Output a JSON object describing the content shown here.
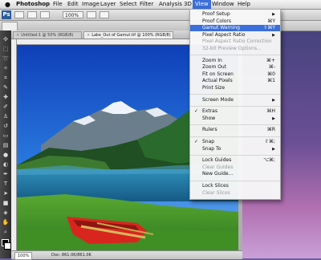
{
  "menubar": {
    "apple": "",
    "app": "Photoshop",
    "items": [
      "File",
      "Edit",
      "Image",
      "Layer",
      "Select",
      "Filter",
      "Analysis",
      "3D",
      "View",
      "Window",
      "Help"
    ]
  },
  "optionsbar": {
    "zoom": "100%"
  },
  "tabs": [
    {
      "label": "Untitled-1 @ 50% (RGB/8)"
    },
    {
      "label": "Lake_Out of Gamut.tif @ 100% (RGB/8)"
    }
  ],
  "window_title": "Lake_Out of Gamut.tif @ 100% (RGB/8)",
  "status": {
    "zoom": "100%",
    "doc": "Doc: 861.0K/861.0K"
  },
  "view_menu": {
    "groups": [
      [
        {
          "label": "Proof Setup",
          "shortcut": "▶",
          "state": "normal"
        },
        {
          "label": "Proof Colors",
          "shortcut": "⌘Y",
          "state": "normal"
        },
        {
          "label": "Gamut Warning",
          "shortcut": "⇧⌘Y",
          "state": "highlight"
        },
        {
          "label": "Pixel Aspect Ratio",
          "shortcut": "▶",
          "state": "normal"
        },
        {
          "label": "Pixel Aspect Ratio Correction",
          "shortcut": "",
          "state": "disabled"
        },
        {
          "label": "32-bit Preview Options...",
          "shortcut": "",
          "state": "disabled"
        }
      ],
      [
        {
          "label": "Zoom In",
          "shortcut": "⌘+",
          "state": "normal"
        },
        {
          "label": "Zoom Out",
          "shortcut": "⌘-",
          "state": "normal"
        },
        {
          "label": "Fit on Screen",
          "shortcut": "⌘0",
          "state": "normal"
        },
        {
          "label": "Actual Pixels",
          "shortcut": "⌘1",
          "state": "normal"
        },
        {
          "label": "Print Size",
          "shortcut": "",
          "state": "normal"
        }
      ],
      [
        {
          "label": "Screen Mode",
          "shortcut": "▶",
          "state": "normal"
        }
      ],
      [
        {
          "label": "Extras",
          "shortcut": "⌘H",
          "state": "checked"
        },
        {
          "label": "Show",
          "shortcut": "▶",
          "state": "normal"
        }
      ],
      [
        {
          "label": "Rulers",
          "shortcut": "⌘R",
          "state": "normal"
        }
      ],
      [
        {
          "label": "Snap",
          "shortcut": "⇧⌘;",
          "state": "checked"
        },
        {
          "label": "Snap To",
          "shortcut": "▶",
          "state": "normal"
        }
      ],
      [
        {
          "label": "Lock Guides",
          "shortcut": "⌥⌘;",
          "state": "normal"
        },
        {
          "label": "Clear Guides",
          "shortcut": "",
          "state": "disabled"
        },
        {
          "label": "New Guide...",
          "shortcut": "",
          "state": "normal"
        }
      ],
      [
        {
          "label": "Lock Slices",
          "shortcut": "",
          "state": "normal"
        },
        {
          "label": "Clear Slices",
          "shortcut": "",
          "state": "disabled"
        }
      ]
    ]
  },
  "colors": {
    "highlight": "#3b6fd9",
    "sky": "#1a5fd4",
    "lake": "#1f7bb0",
    "grass": "#4c9a2a",
    "boat": "#d8261f"
  }
}
